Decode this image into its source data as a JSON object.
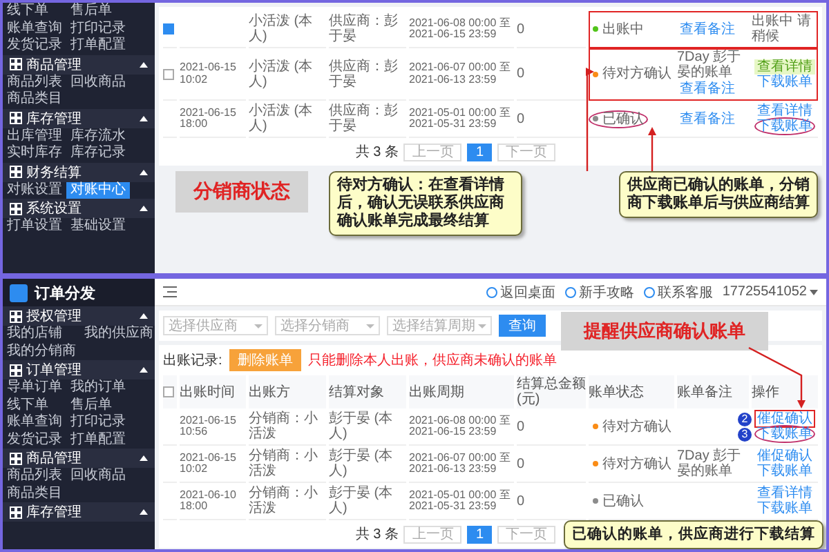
{
  "top_panel": {
    "sidebar": {
      "sections": [
        {
          "items": [
            {
              "label": "线下单",
              "selected": false
            },
            {
              "label": "售后单",
              "selected": false
            },
            {
              "label": "账单查询",
              "selected": false
            },
            {
              "label": "打印记录",
              "selected": false
            },
            {
              "label": "发货记录",
              "selected": false
            },
            {
              "label": "打单配置",
              "selected": false
            }
          ]
        },
        {
          "title": "商品管理",
          "expanded": true,
          "items": [
            {
              "label": "商品列表",
              "selected": false
            },
            {
              "label": "回收商品",
              "selected": false
            },
            {
              "label": "商品类目",
              "selected": false
            }
          ]
        },
        {
          "title": "库存管理",
          "expanded": true,
          "items": [
            {
              "label": "出库管理",
              "selected": false
            },
            {
              "label": "库存流水",
              "selected": false
            },
            {
              "label": "实时库存",
              "selected": false
            },
            {
              "label": "库存记录",
              "selected": false
            }
          ]
        },
        {
          "title": "财务结算",
          "expanded": true,
          "items": [
            {
              "label": "对账设置",
              "selected": false
            },
            {
              "label": "对账中心",
              "selected": true
            }
          ]
        },
        {
          "title": "系统设置",
          "expanded": true,
          "items": [
            {
              "label": "打单设置",
              "selected": false
            },
            {
              "label": "基础设置",
              "selected": false
            }
          ]
        }
      ]
    },
    "table": {
      "rows": [
        {
          "checked": true,
          "boxed": true,
          "party": "小活泼 (本人)",
          "target": "供应商：彭于晏",
          "period": "2021-06-08 00:00 至 2021-06-15 23:59",
          "amount": "0",
          "status": {
            "label": "出账中",
            "color": "#52c41a",
            "circled": false
          },
          "remark": [
            {
              "text": "查看备注",
              "kind": "link"
            }
          ],
          "ops": [
            {
              "label": "出账中 请稍候",
              "kind": "text",
              "circled": false,
              "boxed": false
            }
          ]
        },
        {
          "checked": false,
          "boxed": true,
          "time": "2021-06-15 10:02",
          "party": "小活泼 (本人)",
          "target": "供应商：彭于晏",
          "period": "2021-06-07 00:00 至 2021-06-13 23:59",
          "amount": "0",
          "status": {
            "label": "待对方确认",
            "color": "#fa8c16",
            "circled": false
          },
          "remark": [
            {
              "text": "7Day 彭于晏的账单",
              "kind": "text"
            },
            {
              "text": "查看备注",
              "kind": "link"
            }
          ],
          "ops": [
            {
              "label": "查看详情",
              "kind": "tag",
              "circled": false,
              "boxed": false
            },
            {
              "label": "下载账单",
              "kind": "link",
              "circled": false,
              "boxed": false
            }
          ]
        },
        {
          "boxed": false,
          "time": "2021-06-15 18:00",
          "party": "小活泼 (本人)",
          "target": "供应商：彭于晏",
          "period": "2021-05-01 00:00 至 2021-05-31 23:59",
          "amount": "0",
          "status": {
            "label": "已确认",
            "color": "#8c8c8c",
            "circled": true
          },
          "remark": [
            {
              "text": "查看备注",
              "kind": "link"
            }
          ],
          "ops": [
            {
              "label": "查看详情",
              "kind": "link",
              "circled": false,
              "boxed": false
            },
            {
              "label": "下载账单",
              "kind": "link",
              "circled": true,
              "boxed": false
            }
          ]
        }
      ]
    },
    "pagination": {
      "total": "共 3 条",
      "prev": "上一页",
      "pages": [
        {
          "label": "1",
          "selected": true
        }
      ],
      "next": "下一页"
    },
    "annotations": [
      {
        "kind": "label",
        "text": "分销商状态"
      },
      {
        "kind": "callout",
        "text": "待对方确认：在查看详情后，确认无误联系供应商确认账单完成最终结算"
      },
      {
        "kind": "callout",
        "text": "供应商已确认的账单，分销商下载账单后与供应商结算"
      }
    ]
  },
  "bottom_panel": {
    "logo": "订单分发",
    "sidebar": {
      "sections": [
        {
          "title": "授权管理",
          "expanded": true,
          "items": [
            {
              "label": "我的店铺",
              "selected": false
            },
            {
              "label": "我的供应商",
              "selected": false
            },
            {
              "label": "我的分销商",
              "selected": false
            }
          ]
        },
        {
          "title": "订单管理",
          "expanded": true,
          "items": [
            {
              "label": "导单订单",
              "selected": false
            },
            {
              "label": "我的订单",
              "selected": false
            },
            {
              "label": "线下单",
              "selected": false
            },
            {
              "label": "售后单",
              "selected": false
            },
            {
              "label": "账单查询",
              "selected": false
            },
            {
              "label": "打印记录",
              "selected": false
            },
            {
              "label": "发货记录",
              "selected": false
            },
            {
              "label": "打单配置",
              "selected": false
            }
          ]
        },
        {
          "title": "商品管理",
          "expanded": true,
          "items": [
            {
              "label": "商品列表",
              "selected": false
            },
            {
              "label": "回收商品",
              "selected": false
            },
            {
              "label": "商品类目",
              "selected": false
            }
          ]
        },
        {
          "title": "库存管理",
          "expanded": true
        }
      ]
    },
    "header": {
      "links": [
        {
          "label": "返回桌面"
        },
        {
          "label": "新手攻略"
        },
        {
          "label": "联系客服"
        }
      ],
      "account": "17725541052"
    },
    "filters": {
      "selects": [
        {
          "placeholder": "选择供应商"
        },
        {
          "placeholder": "选择分销商"
        },
        {
          "placeholder": "选择结算周期"
        }
      ],
      "search": "查询"
    },
    "actions": {
      "label": "出账记录:",
      "button": "删除账单",
      "hint": "只能删除本人出账，供应商未确认的账单"
    },
    "table": {
      "header_checked": false,
      "columns": [
        "出账时间",
        "出账方",
        "结算对象",
        "出账周期",
        "结算总金额 (元)",
        "账单状态",
        "账单备注",
        "操作"
      ],
      "rows": [
        {
          "time": "2021-06-15 10:56",
          "party": "分销商：小活泼",
          "target": "彭于晏 (本人)",
          "period": "2021-06-08 00:00 至 2021-06-15 23:59",
          "amount": "0",
          "status": {
            "label": "待对方确认",
            "color": "#fa8c16",
            "circled": false
          },
          "ops": [
            {
              "label": "催促确认",
              "kind": "link",
              "circled": false,
              "boxed": true,
              "badge": "2"
            },
            {
              "label": "下载账单",
              "kind": "link",
              "circled": true,
              "boxed": false,
              "badge": "3"
            }
          ]
        },
        {
          "time": "2021-06-15 10:02",
          "party": "分销商：小活泼",
          "target": "彭于晏 (本人)",
          "period": "2021-06-07 00:00 至 2021-06-13 23:59",
          "amount": "0",
          "status": {
            "label": "待对方确认",
            "color": "#fa8c16",
            "circled": false
          },
          "remark": [
            {
              "text": "7Day 彭于晏的账单",
              "kind": "text"
            }
          ],
          "ops": [
            {
              "label": "催促确认",
              "kind": "link",
              "circled": false,
              "boxed": false
            },
            {
              "label": "下载账单",
              "kind": "link",
              "circled": false,
              "boxed": false
            }
          ]
        },
        {
          "time": "2021-06-10 18:00",
          "party": "分销商：小活泼",
          "target": "彭于晏 (本人)",
          "period": "2021-05-01 00:00 至 2021-05-31 23:59",
          "amount": "0",
          "status": {
            "label": "已确认",
            "color": "#8c8c8c",
            "circled": false
          },
          "ops": [
            {
              "label": "查看详情",
              "kind": "link",
              "circled": false,
              "boxed": false
            },
            {
              "label": "下载账单",
              "kind": "link",
              "circled": false,
              "boxed": false
            }
          ]
        }
      ]
    },
    "pagination": {
      "total": "共 3 条",
      "prev": "上一页",
      "pages": [
        {
          "label": "1",
          "selected": true
        }
      ],
      "next": "下一页"
    },
    "annotations": [
      {
        "kind": "label",
        "text": "提醒供应商确认账单"
      },
      {
        "kind": "callout",
        "text": "已确认的账单，供应商进行下载结算"
      }
    ]
  }
}
